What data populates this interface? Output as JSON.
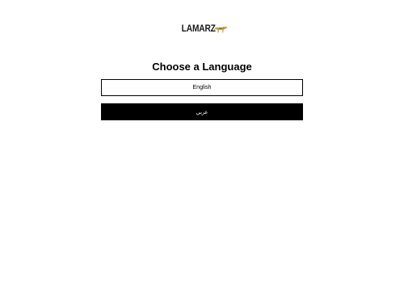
{
  "brand": {
    "name": "LAMARZ",
    "logo_icon": "leopard-icon",
    "logo_text_color": "#1a1a1a",
    "logo_icon_color": "#c9a24a"
  },
  "heading": "Choose a Language",
  "languages": [
    {
      "label": "English",
      "style": "outlined"
    },
    {
      "label": "عربي",
      "style": "filled"
    }
  ],
  "colors": {
    "background": "#ffffff",
    "primary": "#000000",
    "on_primary": "#ffffff"
  }
}
